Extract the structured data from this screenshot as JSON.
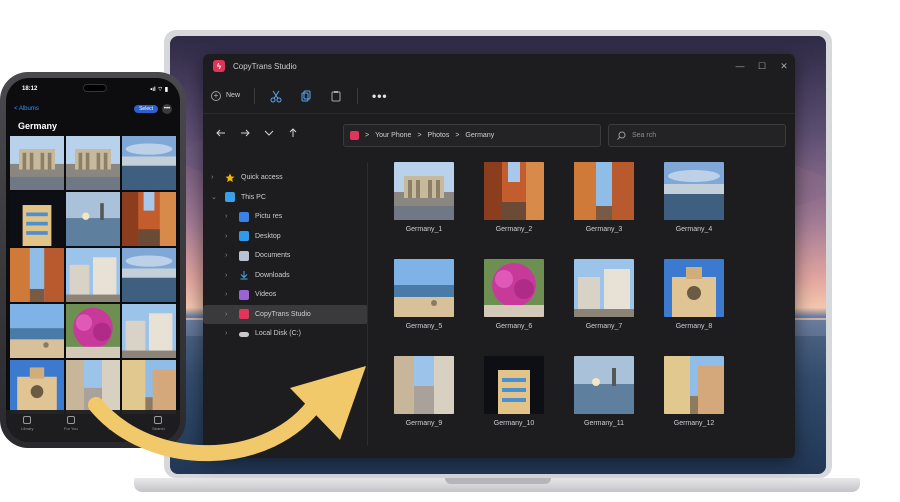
{
  "window": {
    "title": "CopyTrans Studio",
    "controls": {
      "minimize": "—",
      "maximize": "☐",
      "close": "✕"
    }
  },
  "toolbar": {
    "new_label": "New",
    "more_label": "•••",
    "icons": [
      "cut-icon",
      "copy-icon",
      "paste-icon"
    ]
  },
  "navigation": {
    "path": [
      "Your Phone",
      "Photos",
      "Germany"
    ],
    "separator": ">",
    "search_placeholder": "Sea rch"
  },
  "sidebar": {
    "items": [
      {
        "label": "Quick access",
        "icon": "star-icon",
        "color": "#f5b800"
      },
      {
        "label": "This PC",
        "icon": "monitor-icon",
        "color": "#3aa0e8"
      },
      {
        "label": "Pictu res",
        "icon": "pictures-icon",
        "color": "#3a82e8"
      },
      {
        "label": "Desktop",
        "icon": "desktop-icon",
        "color": "#2f9be8"
      },
      {
        "label": "Documents",
        "icon": "documents-icon",
        "color": "#b8c4d4"
      },
      {
        "label": "Downloads",
        "icon": "download-icon",
        "color": "#4aa8e8"
      },
      {
        "label": "Videos",
        "icon": "videos-icon",
        "color": "#9a63d6"
      },
      {
        "label": "CopyTrans Studio",
        "icon": "copytrans-icon",
        "color": "#e0345a"
      },
      {
        "label": "Local Disk (C:)",
        "icon": "disk-icon",
        "color": "#c9c9cc"
      }
    ],
    "active_index": 7
  },
  "files": [
    {
      "name": "Germany_1"
    },
    {
      "name": "Germany_2"
    },
    {
      "name": "Germany_3"
    },
    {
      "name": "Germany_4"
    },
    {
      "name": "Germany_5"
    },
    {
      "name": "Germany_6"
    },
    {
      "name": "Germany_7"
    },
    {
      "name": "Germany_8"
    },
    {
      "name": "Germany_9"
    },
    {
      "name": "Germany_10"
    },
    {
      "name": "Germany_11"
    },
    {
      "name": "Germany_12"
    }
  ],
  "phone": {
    "time": "18:12",
    "status_right": "•ıl ⌔ ▮",
    "back_label": "< Albums",
    "select_label": "Select",
    "more_label": "•••",
    "album_title": "Germany",
    "tabs": [
      {
        "label": "Library",
        "active": false
      },
      {
        "label": "For You",
        "active": false
      },
      {
        "label": "Albums",
        "active": true
      },
      {
        "label": "Search",
        "active": false
      }
    ]
  },
  "colors": {
    "accent": "#e0345a",
    "arrow": "#f2c96a",
    "window_bg": "#1d1d1f"
  }
}
